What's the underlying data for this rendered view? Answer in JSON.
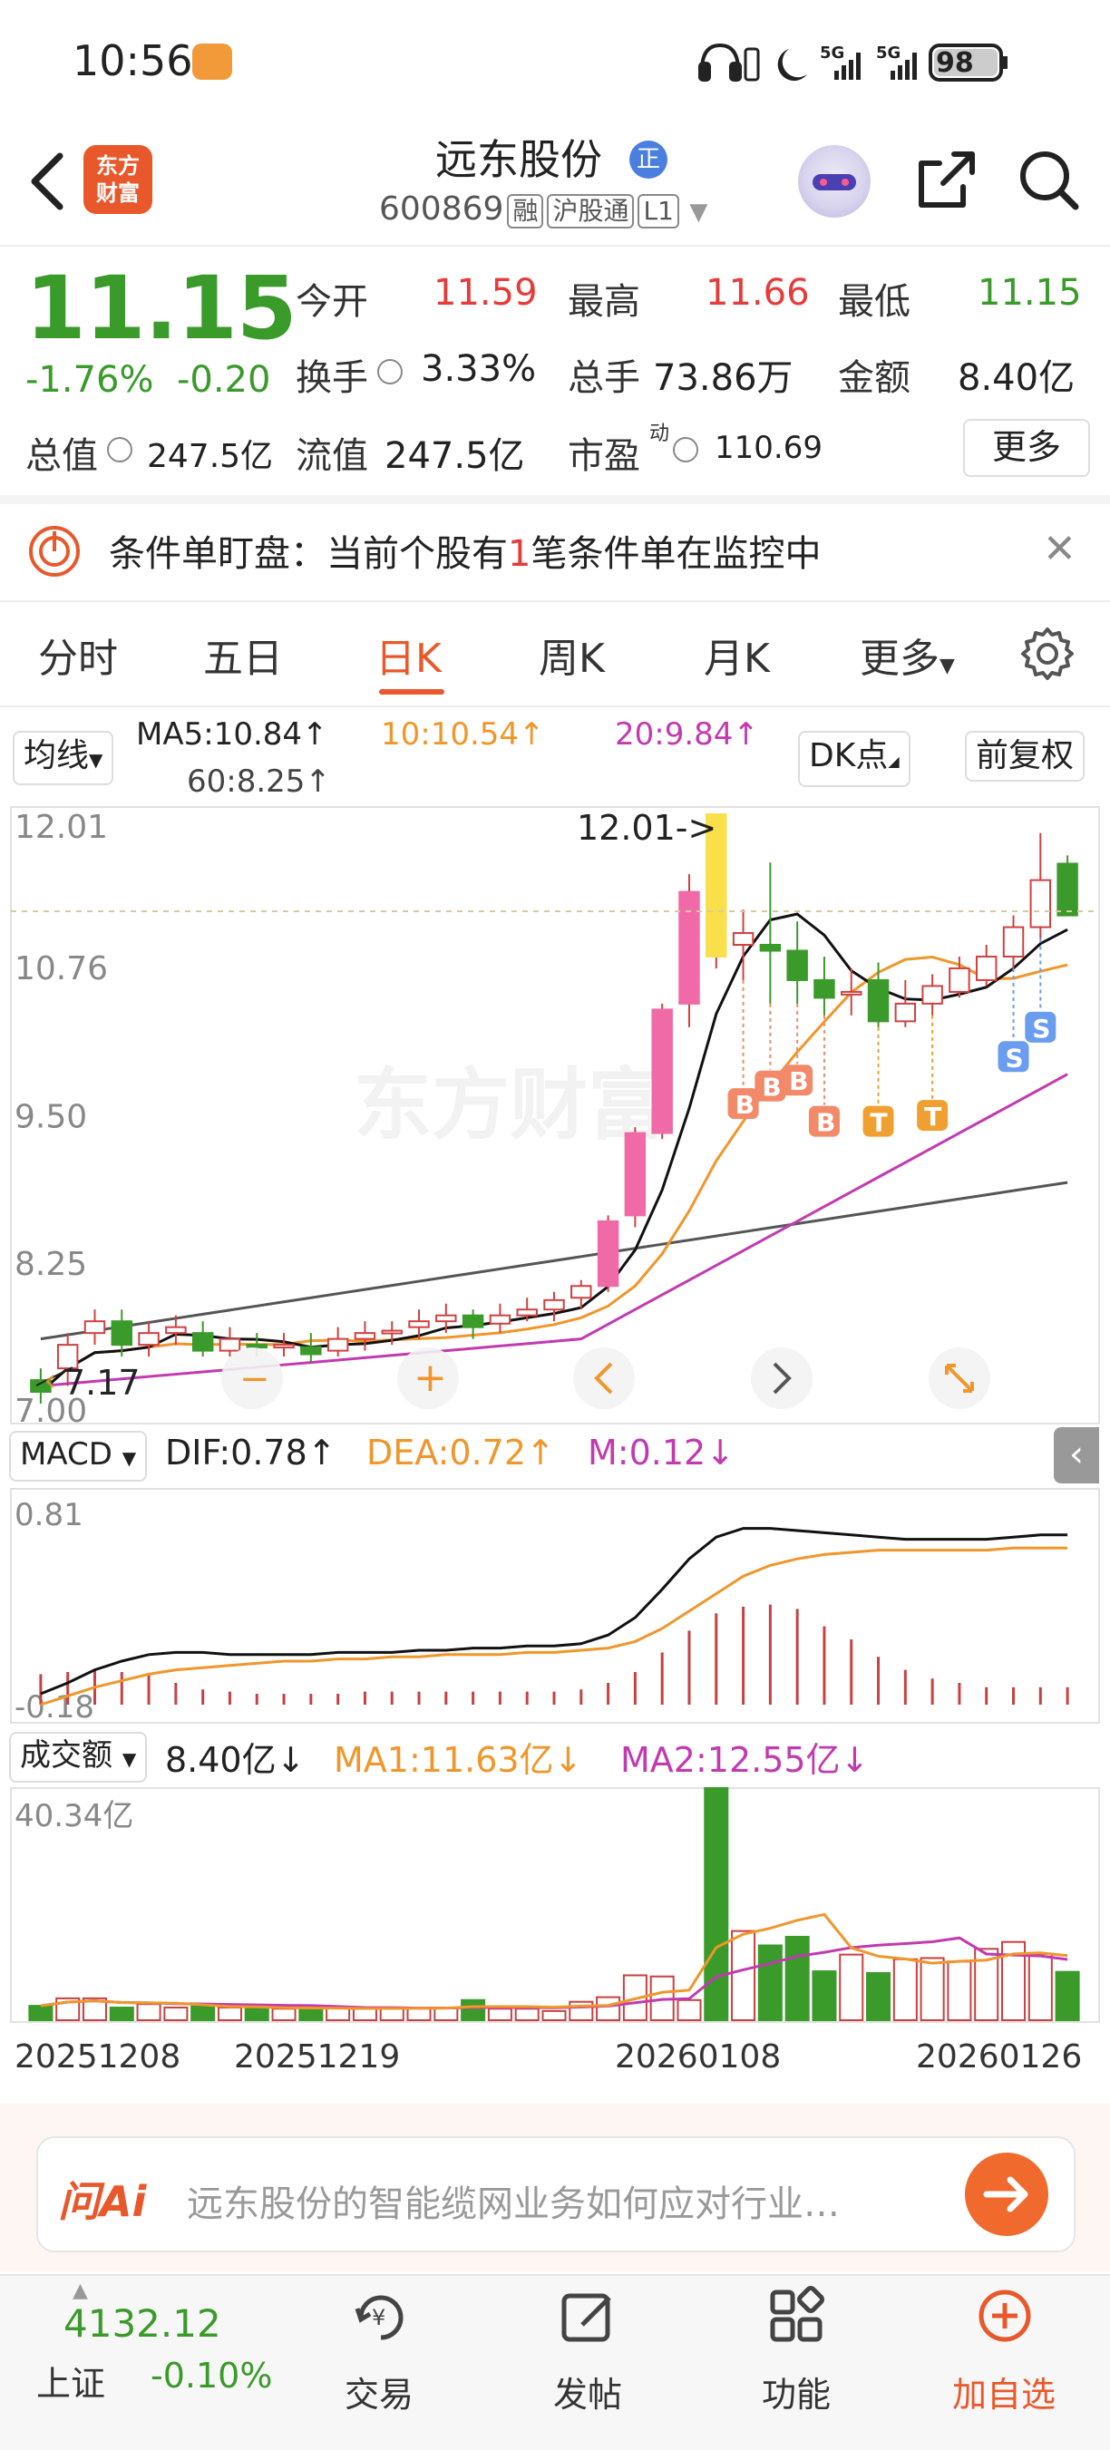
{
  "status_bar": {
    "time": "10:56",
    "battery": "98",
    "signal1": "5G",
    "signal2": "5G"
  },
  "header": {
    "logo_text_1": "东方",
    "logo_text_2": "财富",
    "name": "远东股份",
    "zheng_badge": "正",
    "code": "600869",
    "tags": [
      "融",
      "沪股通",
      "L1"
    ]
  },
  "quote": {
    "price": "11.15",
    "change_pct": "-1.76%",
    "change": "-0.20",
    "open_label": "今开",
    "open": "11.59",
    "high_label": "最高",
    "high": "11.66",
    "low_label": "最低",
    "low": "11.15",
    "turnover_label": "换手",
    "turnover": "3.33%",
    "volume_label": "总手",
    "volume": "73.86万",
    "amount_label": "金额",
    "amount": "8.40亿",
    "mktcap_label": "总值",
    "mktcap": "247.5亿",
    "float_label": "流值",
    "float": "247.5亿",
    "pe_label": "市盈",
    "pe_sup": "动",
    "pe": "110.69",
    "more": "更多"
  },
  "banner": {
    "text_pre": "条件单盯盘：当前个股有",
    "count": "1",
    "text_post": "笔条件单在监控中"
  },
  "tabs": [
    "分时",
    "五日",
    "日K",
    "周K",
    "月K",
    "更多"
  ],
  "ma_row": {
    "selector": "均线",
    "ma5": "MA5:10.84↑",
    "ma10": "10:10.54↑",
    "ma20": "20:9.84↑",
    "ma60": "60:8.25↑",
    "dk": "DK点",
    "fuquan": "前复权"
  },
  "kline": {
    "y_labels": [
      "12.01",
      "10.76",
      "9.50",
      "8.25",
      "7.00"
    ],
    "max_annot": "12.01->",
    "min_annot": "7.17",
    "watermark": "东方财富",
    "markers": [
      "B",
      "B",
      "B",
      "B",
      "T",
      "T",
      "S",
      "S"
    ]
  },
  "macd": {
    "selector": "MACD",
    "dif": "DIF:0.78↑",
    "dea": "DEA:0.72↑",
    "m": "M:0.12↓",
    "y_top": "0.81",
    "y_bottom": "-0.18"
  },
  "volume_panel": {
    "selector": "成交额",
    "value": "8.40亿↓",
    "ma1": "MA1:11.63亿↓",
    "ma2": "MA2:12.55亿↓",
    "y_top": "40.34亿"
  },
  "dates": [
    "20251208",
    "20251219",
    "20260108",
    "20260126"
  ],
  "chart_data": {
    "type": "candlestick",
    "ylim": [
      7.0,
      12.01
    ],
    "candles": [
      {
        "o": 7.2,
        "c": 7.1,
        "h": 7.3,
        "l": 7.0
      },
      {
        "o": 7.3,
        "c": 7.5,
        "h": 7.6,
        "l": 7.15
      },
      {
        "o": 7.6,
        "c": 7.7,
        "h": 7.8,
        "l": 7.5
      },
      {
        "o": 7.7,
        "c": 7.5,
        "h": 7.8,
        "l": 7.4
      },
      {
        "o": 7.5,
        "c": 7.6,
        "h": 7.7,
        "l": 7.4
      },
      {
        "o": 7.6,
        "c": 7.65,
        "h": 7.75,
        "l": 7.5
      },
      {
        "o": 7.6,
        "c": 7.45,
        "h": 7.7,
        "l": 7.4
      },
      {
        "o": 7.45,
        "c": 7.55,
        "h": 7.65,
        "l": 7.4
      },
      {
        "o": 7.5,
        "c": 7.48,
        "h": 7.6,
        "l": 7.4
      },
      {
        "o": 7.5,
        "c": 7.5,
        "h": 7.6,
        "l": 7.4
      },
      {
        "o": 7.48,
        "c": 7.42,
        "h": 7.6,
        "l": 7.35
      },
      {
        "o": 7.45,
        "c": 7.55,
        "h": 7.65,
        "l": 7.4
      },
      {
        "o": 7.55,
        "c": 7.6,
        "h": 7.7,
        "l": 7.45
      },
      {
        "o": 7.6,
        "c": 7.62,
        "h": 7.7,
        "l": 7.5
      },
      {
        "o": 7.65,
        "c": 7.7,
        "h": 7.8,
        "l": 7.55
      },
      {
        "o": 7.7,
        "c": 7.75,
        "h": 7.85,
        "l": 7.6
      },
      {
        "o": 7.75,
        "c": 7.65,
        "h": 7.8,
        "l": 7.55
      },
      {
        "o": 7.68,
        "c": 7.75,
        "h": 7.85,
        "l": 7.6
      },
      {
        "o": 7.75,
        "c": 7.8,
        "h": 7.9,
        "l": 7.7
      },
      {
        "o": 7.8,
        "c": 7.88,
        "h": 7.95,
        "l": 7.7
      },
      {
        "o": 7.9,
        "c": 8.0,
        "h": 8.05,
        "l": 7.8
      },
      {
        "o": 8.0,
        "c": 8.55,
        "h": 8.6,
        "l": 7.95
      },
      {
        "o": 8.6,
        "c": 9.3,
        "h": 9.35,
        "l": 8.5
      },
      {
        "o": 9.3,
        "c": 10.35,
        "h": 10.4,
        "l": 9.25
      },
      {
        "o": 10.4,
        "c": 11.35,
        "h": 11.5,
        "l": 10.2
      },
      {
        "o": 10.8,
        "c": 12.01,
        "h": 12.01,
        "l": 10.7
      },
      {
        "o": 10.9,
        "c": 11.0,
        "h": 11.2,
        "l": 10.6
      },
      {
        "o": 10.9,
        "c": 10.85,
        "h": 11.6,
        "l": 10.4
      },
      {
        "o": 10.85,
        "c": 10.6,
        "h": 11.1,
        "l": 10.4
      },
      {
        "o": 10.6,
        "c": 10.45,
        "h": 10.8,
        "l": 10.3
      },
      {
        "o": 10.5,
        "c": 10.5,
        "h": 10.7,
        "l": 10.3
      },
      {
        "o": 10.6,
        "c": 10.25,
        "h": 10.75,
        "l": 10.2
      },
      {
        "o": 10.25,
        "c": 10.4,
        "h": 10.6,
        "l": 10.2
      },
      {
        "o": 10.4,
        "c": 10.55,
        "h": 10.65,
        "l": 10.3
      },
      {
        "o": 10.5,
        "c": 10.7,
        "h": 10.8,
        "l": 10.45
      },
      {
        "o": 10.6,
        "c": 10.8,
        "h": 10.9,
        "l": 10.55
      },
      {
        "o": 10.8,
        "c": 11.05,
        "h": 11.15,
        "l": 10.7
      },
      {
        "o": 11.05,
        "c": 11.45,
        "h": 11.85,
        "l": 10.95
      },
      {
        "o": 11.59,
        "c": 11.15,
        "h": 11.66,
        "l": 11.15
      }
    ]
  }
}
